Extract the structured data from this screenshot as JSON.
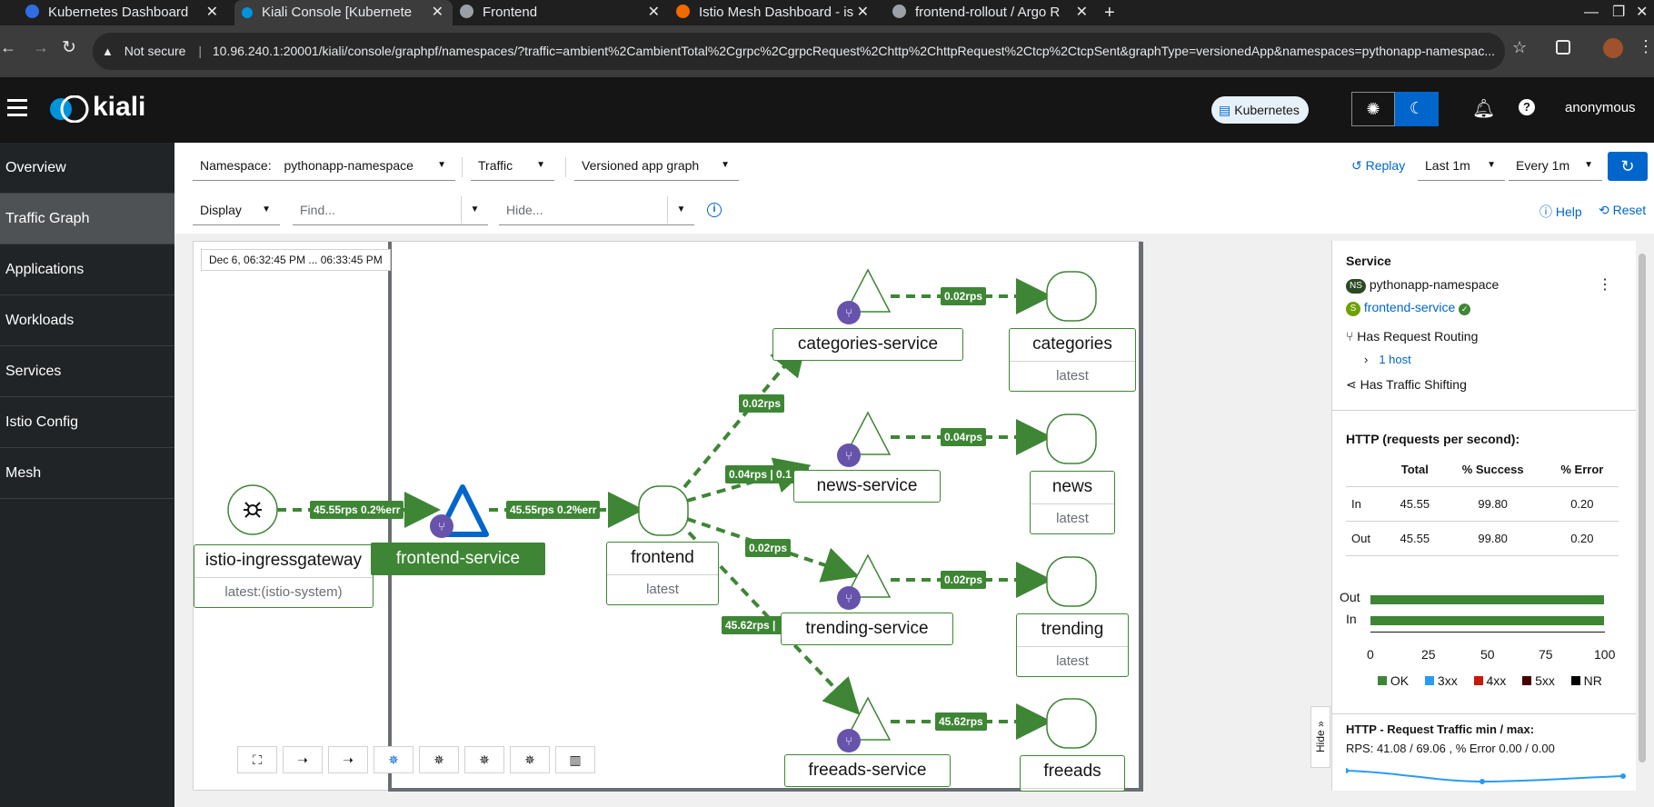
{
  "browser": {
    "tabs": [
      {
        "title": "Kubernetes Dashboard",
        "color": "#326ce5"
      },
      {
        "title": "Kiali Console [Kubernetes]",
        "color": "#0093dd"
      },
      {
        "title": "Frontend",
        "color": "#9aa0a6"
      },
      {
        "title": "Istio Mesh Dashboard - is",
        "color": "#f46800"
      },
      {
        "title": "frontend-rollout / Argo R",
        "color": "#9aa0a6"
      }
    ],
    "new_tab": "+",
    "not_secure": "Not secure",
    "url": "10.96.240.1:20001/kiali/console/graphpf/namespaces/?traffic=ambient%2CambientTotal%2Cgrpc%2CgrpcRequest%2Chttp%2ChttpRequest%2Ctcp%2CtcpSent&graphType=versionedApp&namespaces=pythonapp-namespac..."
  },
  "masthead": {
    "brand": "kiali",
    "platform": "Kubernetes",
    "user": "anonymous"
  },
  "sidebar": {
    "items": [
      {
        "label": "Overview",
        "active": false
      },
      {
        "label": "Traffic Graph",
        "active": true
      },
      {
        "label": "Applications",
        "active": false
      },
      {
        "label": "Workloads",
        "active": false
      },
      {
        "label": "Services",
        "active": false
      },
      {
        "label": "Istio Config",
        "active": false
      },
      {
        "label": "Mesh",
        "active": false
      }
    ]
  },
  "toolbar": {
    "namespace_label": "Namespace:",
    "namespace_value": "pythonapp-namespace",
    "traffic": "Traffic",
    "graph_type": "Versioned app graph",
    "replay": "Replay",
    "duration": "Last 1m",
    "refresh": "Every 1m",
    "display": "Display",
    "find_placeholder": "Find...",
    "hide_placeholder": "Hide...",
    "help": "Help",
    "reset": "Reset"
  },
  "graph": {
    "time_range": "Dec 6, 06:32:45 PM ... 06:33:45 PM",
    "nodes": {
      "ingress_name": "istio-ingressgateway",
      "ingress_version": "latest:(istio-system)",
      "frontend_service": "frontend-service",
      "frontend_name": "frontend",
      "frontend_version": "latest",
      "categories_service": "categories-service",
      "news_service": "news-service",
      "trending_service": "trending-service",
      "freeads_service": "freeads-service",
      "categories": "categories",
      "news": "news",
      "trending": "trending",
      "freeads": "freeads",
      "latest": "latest"
    },
    "edges": {
      "ingress_to_frontend": "45.55rps 0.2%err",
      "frontend_service_to_frontend": "45.55rps 0.2%err",
      "to_categories_service": "0.02rps",
      "to_news_service": "0.04rps | 0.1",
      "to_trending_service": "0.02rps",
      "to_freeads_service": "45.62rps |",
      "categories": "0.02rps",
      "news": "0.04rps",
      "trending": "0.02rps",
      "freeads": "45.62rps"
    }
  },
  "panel": {
    "title": "Service",
    "ns_badge": "NS",
    "namespace": "pythonapp-namespace",
    "svc_badge": "S",
    "service": "frontend-service",
    "request_routing": "Has Request Routing",
    "hosts": "1 host",
    "traffic_shifting": "Has Traffic Shifting",
    "http_title": "HTTP (requests per second):",
    "table": {
      "headers": [
        "",
        "Total",
        "% Success",
        "% Error"
      ],
      "rows": [
        [
          "In",
          "45.55",
          "99.80",
          "0.20"
        ],
        [
          "Out",
          "45.55",
          "99.80",
          "0.20"
        ]
      ]
    },
    "bars": {
      "labels": [
        "Out",
        "In"
      ],
      "ok_percent": [
        99.8,
        99.8
      ],
      "ticks": [
        "0",
        "25",
        "50",
        "75",
        "100"
      ]
    },
    "legend": [
      {
        "label": "OK",
        "color": "#3e8635"
      },
      {
        "label": "3xx",
        "color": "#2b9af3"
      },
      {
        "label": "4xx",
        "color": "#c9190b"
      },
      {
        "label": "5xx",
        "color": "#470000"
      },
      {
        "label": "NR",
        "color": "#000000"
      }
    ],
    "traffic_title": "HTTP - Request Traffic min / max:",
    "traffic_stats": "RPS: 41.08 / 69.06 , % Error 0.00 / 0.00",
    "hide": "Hide"
  }
}
